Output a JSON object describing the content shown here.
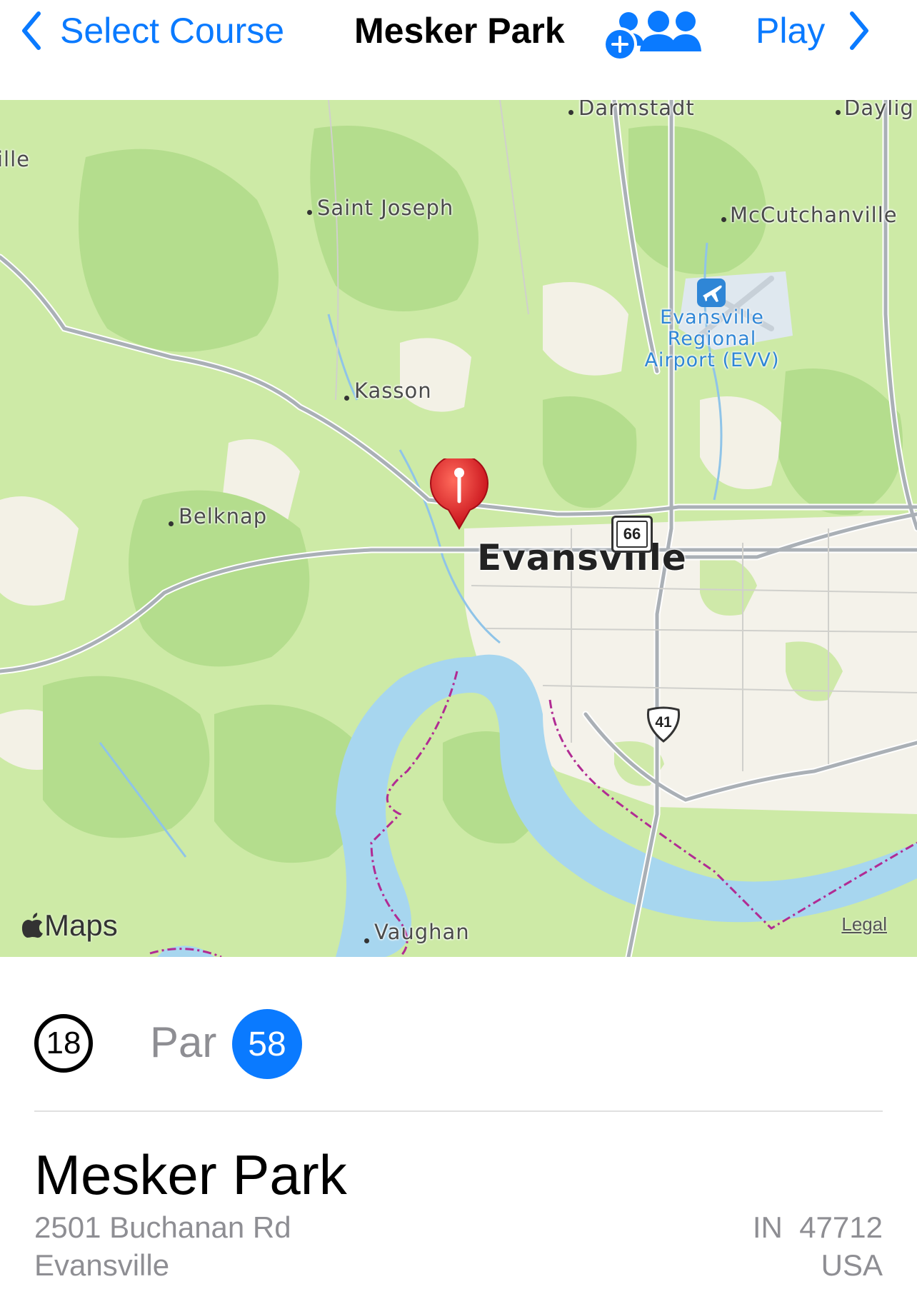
{
  "nav": {
    "back_label": "Select Course",
    "title": "Mesker Park",
    "play_label": "Play",
    "players_icon": "add-players-icon",
    "accent": "#0a7aff"
  },
  "map": {
    "labels": {
      "darmstadt": "Darmstadt",
      "daylight": "Daylig",
      "ville": "ille",
      "saint_joseph": "Saint Joseph",
      "mccutchanville": "McCutchanville",
      "airport_l1": "Evansville",
      "airport_l2": "Regional",
      "airport_l3": "Airport (EVV)",
      "kasson": "Kasson",
      "belknap": "Belknap",
      "evansville": "Evansville",
      "vaughan": "Vaughan",
      "route_66": "66",
      "route_41": "41"
    },
    "logo_text": "Maps",
    "legal": "Legal",
    "pin_icon": "golf-pin-icon"
  },
  "course": {
    "holes": "18",
    "par_label": "Par",
    "par_value": "58",
    "name": "Mesker Park",
    "street": "2501 Buchanan Rd",
    "city": "Evansville",
    "state_zip": "IN  47712",
    "country": "USA"
  }
}
